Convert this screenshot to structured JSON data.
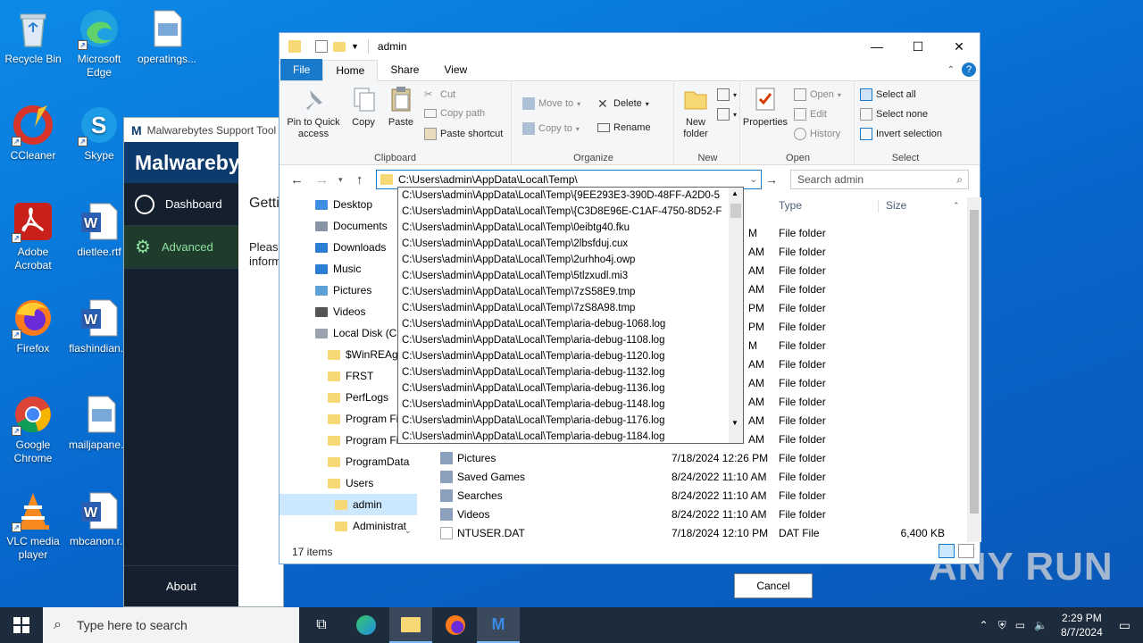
{
  "desktop": {
    "icons": [
      {
        "label": "Recycle Bin",
        "icon": "recycle-bin-icon"
      },
      {
        "label": "Microsoft Edge",
        "icon": "edge-icon"
      },
      {
        "label": "operatings...",
        "icon": "image-file-icon"
      },
      {
        "label": "CCleaner",
        "icon": "ccleaner-icon"
      },
      {
        "label": "Skype",
        "icon": "skype-icon"
      },
      {
        "label": "Adobe Acrobat",
        "icon": "acrobat-icon"
      },
      {
        "label": "dietlee.rtf",
        "icon": "word-doc-icon"
      },
      {
        "label": "Firefox",
        "icon": "firefox-icon"
      },
      {
        "label": "flashindian...",
        "icon": "word-doc-icon"
      },
      {
        "label": "Google Chrome",
        "icon": "chrome-icon"
      },
      {
        "label": "mailjapane...",
        "icon": "image-file-icon"
      },
      {
        "label": "VLC media player",
        "icon": "vlc-icon"
      },
      {
        "label": "mbcanon.r...",
        "icon": "word-doc-icon"
      }
    ]
  },
  "malwarebytes": {
    "title": "Malwarebytes Support Tool",
    "logo": "Malwarebytes",
    "nav": [
      {
        "label": "Dashboard"
      },
      {
        "label": "Advanced"
      }
    ],
    "about": "About",
    "heading": "Getti",
    "body_line1": "Please",
    "body_line2": "inform",
    "cancel": "Cancel"
  },
  "explorer": {
    "title": "admin",
    "tabs": [
      "File",
      "Home",
      "Share",
      "View"
    ],
    "ribbon": {
      "clipboard": {
        "label": "Clipboard",
        "pin": "Pin to Quick access",
        "copy": "Copy",
        "paste": "Paste",
        "cut": "Cut",
        "copy_path": "Copy path",
        "paste_shortcut": "Paste shortcut"
      },
      "organize": {
        "label": "Organize",
        "move_to": "Move to",
        "copy_to": "Copy to",
        "delete": "Delete",
        "rename": "Rename"
      },
      "new": {
        "label": "New",
        "new_folder": "New folder"
      },
      "open": {
        "label": "Open",
        "properties": "Properties",
        "open": "Open",
        "edit": "Edit",
        "history": "History"
      },
      "select": {
        "label": "Select",
        "select_all": "Select all",
        "select_none": "Select none",
        "invert": "Invert selection"
      }
    },
    "address": "C:\\Users\\admin\\AppData\\Local\\Temp\\",
    "search_placeholder": "Search admin",
    "tree": [
      {
        "label": "Desktop",
        "kind": "desktop"
      },
      {
        "label": "Documents",
        "kind": "docs"
      },
      {
        "label": "Downloads",
        "kind": "down"
      },
      {
        "label": "Music",
        "kind": "music"
      },
      {
        "label": "Pictures",
        "kind": "pics"
      },
      {
        "label": "Videos",
        "kind": "vids"
      },
      {
        "label": "Local Disk (C:",
        "kind": "disk"
      },
      {
        "label": "$WinREAge",
        "kind": "folder"
      },
      {
        "label": "FRST",
        "kind": "folder"
      },
      {
        "label": "PerfLogs",
        "kind": "folder"
      },
      {
        "label": "Program Fil",
        "kind": "folder"
      },
      {
        "label": "Program Fil",
        "kind": "folder"
      },
      {
        "label": "ProgramData",
        "kind": "folder"
      },
      {
        "label": "Users",
        "kind": "folder"
      },
      {
        "label": "admin",
        "kind": "folder"
      },
      {
        "label": "Administrat",
        "kind": "folder"
      }
    ],
    "columns": {
      "type": "Type",
      "size": "Size"
    },
    "hidden_rows": [
      {
        "date_tail": "M",
        "type": "File folder"
      },
      {
        "date_tail": "AM",
        "type": "File folder"
      },
      {
        "date_tail": "AM",
        "type": "File folder"
      },
      {
        "date_tail": "AM",
        "type": "File folder"
      },
      {
        "date_tail": "PM",
        "type": "File folder"
      },
      {
        "date_tail": "PM",
        "type": "File folder"
      },
      {
        "date_tail": "M",
        "type": "File folder"
      },
      {
        "date_tail": "AM",
        "type": "File folder"
      },
      {
        "date_tail": "AM",
        "type": "File folder"
      },
      {
        "date_tail": "AM",
        "type": "File folder"
      },
      {
        "date_tail": "AM",
        "type": "File folder"
      },
      {
        "date_tail": "AM",
        "type": "File folder"
      }
    ],
    "rows": [
      {
        "name": "Pictures",
        "date": "7/18/2024 12:26 PM",
        "type": "File folder",
        "size": ""
      },
      {
        "name": "Saved Games",
        "date": "8/24/2022 11:10 AM",
        "type": "File folder",
        "size": ""
      },
      {
        "name": "Searches",
        "date": "8/24/2022 11:10 AM",
        "type": "File folder",
        "size": ""
      },
      {
        "name": "Videos",
        "date": "8/24/2022 11:10 AM",
        "type": "File folder",
        "size": ""
      },
      {
        "name": "NTUSER.DAT",
        "date": "7/18/2024 12:10 PM",
        "type": "DAT File",
        "size": "6,400 KB"
      }
    ],
    "status": "17 items"
  },
  "autocomplete": [
    "C:\\Users\\admin\\AppData\\Local\\Temp\\{9EE293E3-390D-48FF-A2D0-5",
    "C:\\Users\\admin\\AppData\\Local\\Temp\\{C3D8E96E-C1AF-4750-8D52-F",
    "C:\\Users\\admin\\AppData\\Local\\Temp\\0eibtg40.fku",
    "C:\\Users\\admin\\AppData\\Local\\Temp\\2lbsfduj.cux",
    "C:\\Users\\admin\\AppData\\Local\\Temp\\2urhho4j.owp",
    "C:\\Users\\admin\\AppData\\Local\\Temp\\5tlzxudl.mi3",
    "C:\\Users\\admin\\AppData\\Local\\Temp\\7zS58E9.tmp",
    "C:\\Users\\admin\\AppData\\Local\\Temp\\7zS8A98.tmp",
    "C:\\Users\\admin\\AppData\\Local\\Temp\\aria-debug-1068.log",
    "C:\\Users\\admin\\AppData\\Local\\Temp\\aria-debug-1108.log",
    "C:\\Users\\admin\\AppData\\Local\\Temp\\aria-debug-1120.log",
    "C:\\Users\\admin\\AppData\\Local\\Temp\\aria-debug-1132.log",
    "C:\\Users\\admin\\AppData\\Local\\Temp\\aria-debug-1136.log",
    "C:\\Users\\admin\\AppData\\Local\\Temp\\aria-debug-1148.log",
    "C:\\Users\\admin\\AppData\\Local\\Temp\\aria-debug-1176.log",
    "C:\\Users\\admin\\AppData\\Local\\Temp\\aria-debug-1184.log"
  ],
  "taskbar": {
    "search_placeholder": "Type here to search",
    "time": "2:29 PM",
    "date": "8/7/2024"
  },
  "watermark": "ANY RUN"
}
